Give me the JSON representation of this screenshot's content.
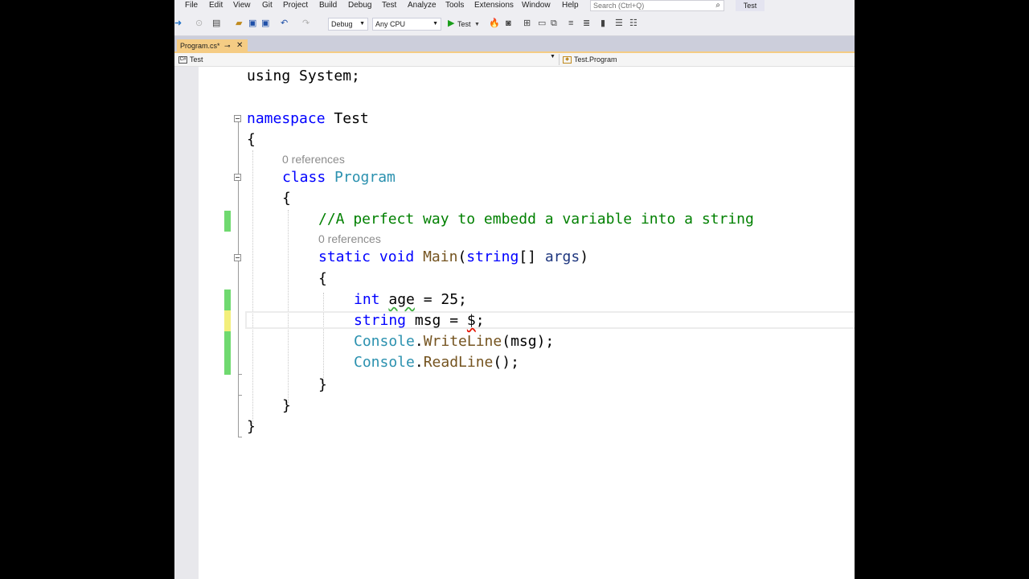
{
  "menu": [
    "File",
    "Edit",
    "View",
    "Git",
    "Project",
    "Build",
    "Debug",
    "Test",
    "Analyze",
    "Tools",
    "Extensions",
    "Window",
    "Help"
  ],
  "search": {
    "placeholder": "Search (Ctrl+Q)"
  },
  "solution_name": "Test",
  "toolbar": {
    "configuration": "Debug",
    "platform": "Any CPU",
    "start_label": "Test"
  },
  "tab": {
    "label": "Program.cs*",
    "pin": "⊸",
    "close": "✕"
  },
  "navbar": {
    "project": "Test",
    "type": "Test.Program"
  },
  "code": {
    "line_using": "using System;",
    "ns_kw": "namespace",
    "ns_name": "Test",
    "brace_open": "{",
    "brace_close": "}",
    "class_refs": "0 references",
    "class_kw": "class",
    "class_name": "Program",
    "comment": "//A perfect way to embedd a variable into a string",
    "main_refs": "0 references",
    "static_kw": "static",
    "void_kw": "void",
    "main_name": "Main",
    "paren_open": "(",
    "string_kw": "string",
    "brackets": "[]",
    "args": "args",
    "paren_close": ")",
    "int_kw": "int",
    "age_var": "age",
    "age_rest": " = 25;",
    "string_kw2": "string",
    "msg_rest": " msg = ",
    "dollar": "$",
    "semicolon": ";",
    "console1": "Console",
    "writeline": "WriteLine",
    "writeline_args": "(msg);",
    "console2": "Console",
    "readline": "ReadLine",
    "readline_args": "();",
    "dot": "."
  }
}
